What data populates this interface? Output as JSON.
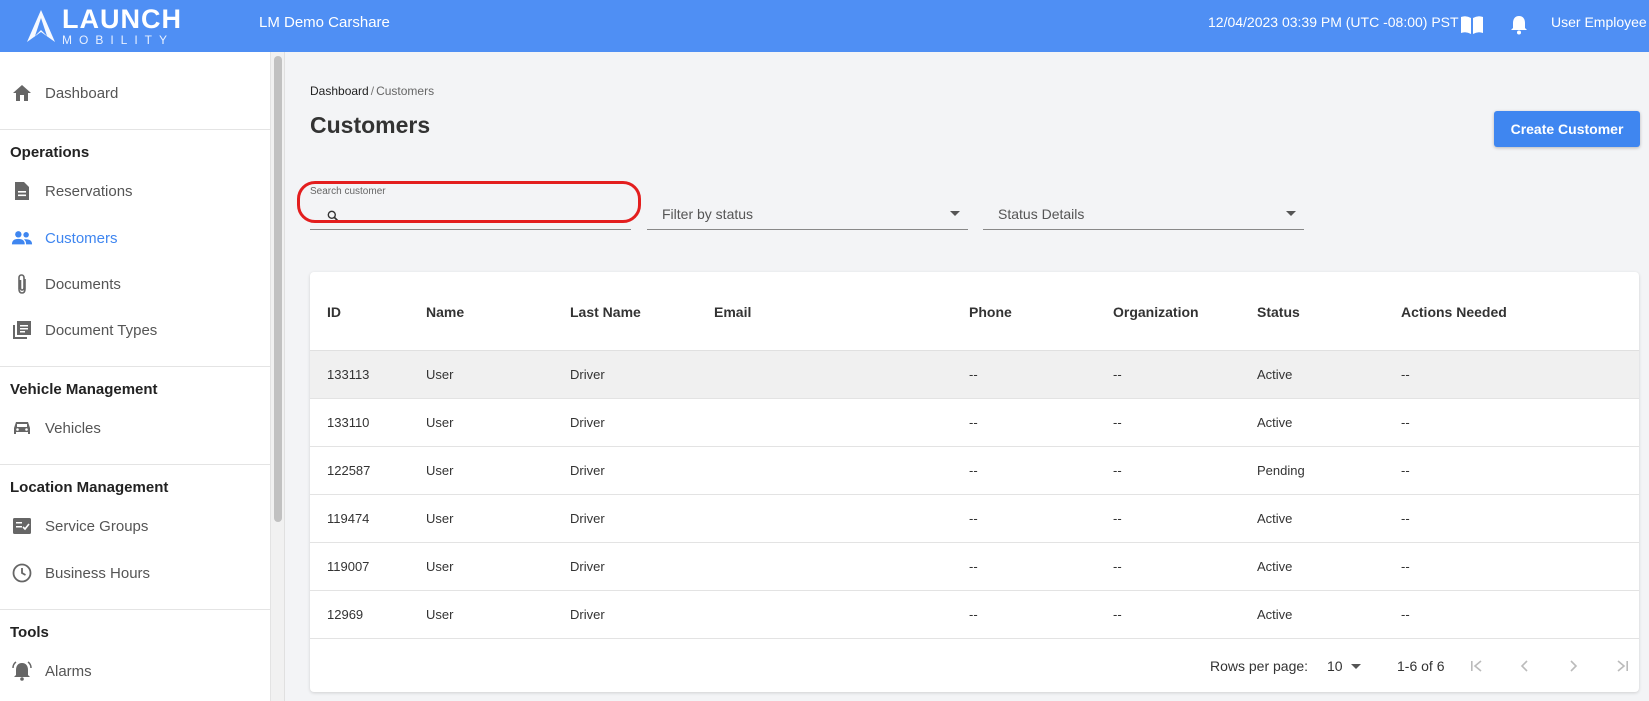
{
  "header": {
    "logo_main": "LAUNCH",
    "logo_sub": "MOBILITY",
    "app_title": "LM Demo Carshare",
    "datetime": "12/04/2023 03:39 PM (UTC -08:00) PST",
    "user_name": "User Employee",
    "bg_color": "#4f8ff4"
  },
  "sidebar": {
    "dashboard": "Dashboard",
    "sections": {
      "operations": "Operations",
      "vehicle_management": "Vehicle Management",
      "location_management": "Location Management",
      "tools": "Tools"
    },
    "items": {
      "reservations": "Reservations",
      "customers": "Customers",
      "documents": "Documents",
      "document_types": "Document Types",
      "vehicles": "Vehicles",
      "service_groups": "Service Groups",
      "business_hours": "Business Hours",
      "alarms": "Alarms"
    },
    "active_item": "customers",
    "active_color": "#3f86f0"
  },
  "main": {
    "breadcrumb": {
      "root": "Dashboard",
      "sep": "/",
      "current": "Customers"
    },
    "title": "Customers",
    "create_button": "Create Customer",
    "search": {
      "label": "Search customer",
      "value": ""
    },
    "filter_status": "Filter by status",
    "status_details": "Status Details"
  },
  "table": {
    "columns": [
      "ID",
      "Name",
      "Last Name",
      "Email",
      "Phone",
      "Organization",
      "Status",
      "Actions Needed"
    ],
    "rows": [
      [
        "133113",
        "User",
        "Driver",
        "",
        "--",
        "--",
        "Active",
        "--"
      ],
      [
        "133110",
        "User",
        "Driver",
        "",
        "--",
        "--",
        "Active",
        "--"
      ],
      [
        "122587",
        "User",
        "Driver",
        "",
        "--",
        "--",
        "Pending",
        "--"
      ],
      [
        "119474",
        "User",
        "Driver",
        "",
        "--",
        "--",
        "Active",
        "--"
      ],
      [
        "119007",
        "User",
        "Driver",
        "",
        "--",
        "--",
        "Active",
        "--"
      ],
      [
        "12969",
        "User",
        "Driver",
        "",
        "--",
        "--",
        "Active",
        "--"
      ]
    ],
    "hovered_row": 0
  },
  "pagination": {
    "rows_per_page_label": "Rows per page:",
    "rows_per_page": "10",
    "range": "1-6 of 6"
  }
}
